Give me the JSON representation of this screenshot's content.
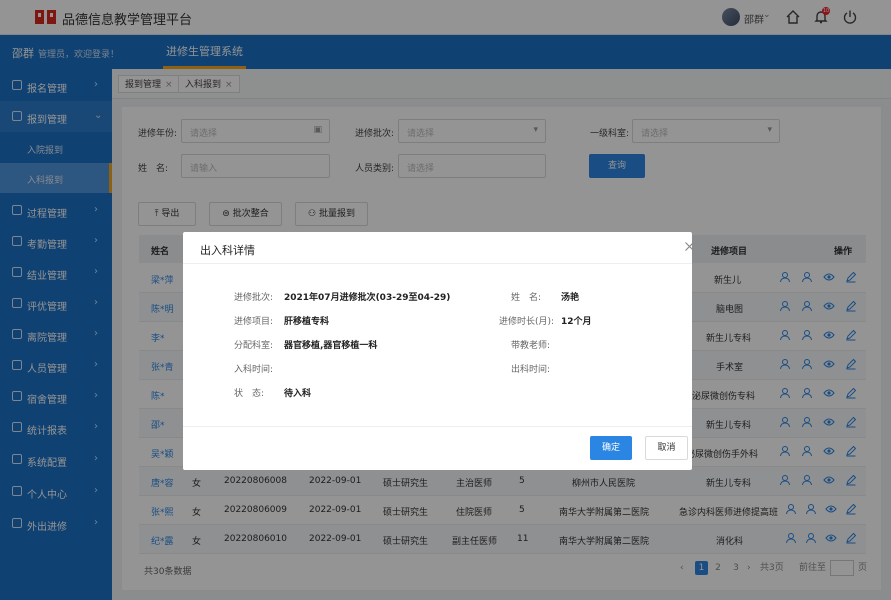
{
  "app": {
    "title": "品德信息教学管理平台"
  },
  "topbar": {
    "user_name": "邵群"
  },
  "header": {
    "user": "邵群",
    "greeting": "管理员，欢迎登录！",
    "system_tab": "进修生管理系统"
  },
  "sidebar": {
    "items": [
      {
        "label": "报名管理"
      },
      {
        "label": "报到管理"
      },
      {
        "label": "过程管理"
      },
      {
        "label": "考勤管理"
      },
      {
        "label": "结业管理"
      },
      {
        "label": "评优管理"
      },
      {
        "label": "离院管理"
      },
      {
        "label": "人员管理"
      },
      {
        "label": "宿舍管理"
      },
      {
        "label": "统计报表"
      },
      {
        "label": "系统配置"
      },
      {
        "label": "个人中心"
      },
      {
        "label": "外出进修"
      }
    ],
    "subitems": [
      {
        "label": "入院报到"
      },
      {
        "label": "入科报到"
      }
    ]
  },
  "breadcrumbs": [
    {
      "label": "报到管理"
    },
    {
      "label": "入科报到"
    }
  ],
  "filters": {
    "year_label": "进修年份:",
    "year_placeholder": "请选择",
    "batch_label": "进修批次:",
    "batch_placeholder": "请选择",
    "dept_label": "一级科室:",
    "dept_placeholder": "请选择",
    "name_label": "姓　名:",
    "name_placeholder": "请输入",
    "type_label": "人员类别:",
    "type_placeholder": "请选择",
    "query_button": "查询"
  },
  "actions": {
    "export": "导出",
    "batch_merge": "批次整合",
    "batch_report": "批量报到"
  },
  "table": {
    "headers": {
      "name": "姓名",
      "project": "进修项目",
      "ops": "操作"
    },
    "rows": [
      {
        "name": "梁*萍",
        "project": "新生儿"
      },
      {
        "name": "陈*明",
        "project": "脑电图"
      },
      {
        "name": "李*",
        "project": "新生儿专科"
      },
      {
        "name": "张*青",
        "project": "手术室"
      },
      {
        "name": "陈*",
        "project": "泌尿微创伤专科"
      },
      {
        "name": "邵*",
        "project": "新生儿专科"
      },
      {
        "name": "吴*颖",
        "project": "泌尿微创伤手外科"
      },
      {
        "name": "唐*容",
        "gender": "女",
        "id": "20220806008",
        "date": "2022-09-01",
        "edu": "硕士研究生",
        "title": "主治医师",
        "years": "5",
        "hospital": "柳州市人民医院",
        "project": "新生儿专科"
      },
      {
        "name": "张*熙",
        "gender": "女",
        "id": "20220806009",
        "date": "2022-09-01",
        "edu": "硕士研究生",
        "title": "住院医师",
        "years": "5",
        "hospital": "南华大学附属第二医院",
        "project": "急诊内科医师进修提高班"
      },
      {
        "name": "纪*露",
        "gender": "女",
        "id": "20220806010",
        "date": "2022-09-01",
        "edu": "硕士研究生",
        "title": "副主任医师",
        "years": "11",
        "hospital": "南华大学附属第二医院",
        "project": "消化科"
      }
    ]
  },
  "pagination": {
    "total": "共30条数据",
    "pages": [
      "1",
      "2",
      "3"
    ],
    "total_pages": "共3页",
    "goto": "前往至",
    "unit": "页"
  },
  "modal": {
    "title": "出入科详情",
    "batch_label": "进修批次:",
    "batch_value": "2021年07月进修批次(03-29至04-29)",
    "name_label": "姓　名:",
    "name_value": "汤艳",
    "project_label": "进修项目:",
    "project_value": "肝移植专科",
    "duration_label": "进修时长(月):",
    "duration_value": "12个月",
    "dept_label": "分配科室:",
    "dept_value": "器官移植,器官移植一科",
    "teacher_label": "带教老师:",
    "in_label": "入科时间:",
    "out_label": "出科时间:",
    "status_label": "状　态:",
    "status_value": "待入科",
    "confirm": "确定",
    "cancel": "取消"
  },
  "colors": {
    "primary": "#1b70c4",
    "accent": "#2b86e3",
    "highlight": "#f5a623"
  }
}
